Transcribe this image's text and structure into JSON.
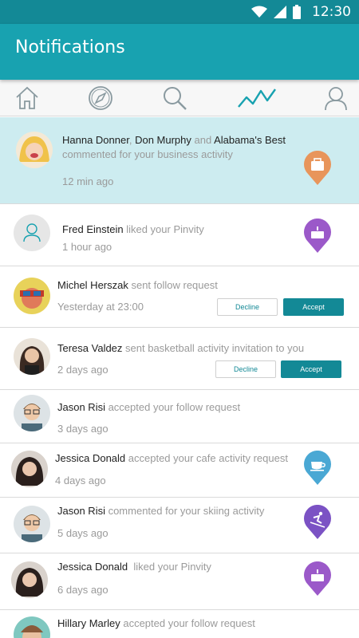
{
  "status_bar": {
    "time": "12:30"
  },
  "app_bar": {
    "title": "Notifications"
  },
  "nav": {
    "items": [
      {
        "name": "home-icon"
      },
      {
        "name": "compass-icon"
      },
      {
        "name": "search-icon"
      },
      {
        "name": "activity-icon",
        "active": true
      },
      {
        "name": "profile-icon"
      }
    ]
  },
  "notifications": [
    {
      "names": [
        "Hanna Donner",
        "Don Murphy",
        "Alabama's Best"
      ],
      "sep1": ", ",
      "conj": " and ",
      "text": "commented for your business activity",
      "time": "12 min ago",
      "badge": "briefcase-icon",
      "highlighted": true
    },
    {
      "name": "Fred Einstein",
      "text": " liked your Pinvity",
      "time": "1 hour ago",
      "badge": "cake-icon"
    },
    {
      "name": "Michel Herszak",
      "text": " sent follow request",
      "time": "Yesterday at 23:00",
      "decline": "Decline",
      "accept": "Accept"
    },
    {
      "name": "Teresa Valdez",
      "text": " sent basketball activity invitation to you",
      "time": "2 days ago",
      "decline": "Decline",
      "accept": "Accept"
    },
    {
      "name": "Jason Risi",
      "text": " accepted your follow request",
      "time": "3 days ago"
    },
    {
      "name": "Jessica Donald",
      "text": " accepted your cafe activity request",
      "time": "4 days ago",
      "badge": "coffee-icon"
    },
    {
      "name": "Jason Risi",
      "text": " commented for your skiing activity",
      "time": "5 days ago",
      "badge": "skiing-icon"
    },
    {
      "name": "Jessica Donald",
      "text": "  liked your Pinvity",
      "time": "6 days ago",
      "badge": "cake-icon"
    },
    {
      "name": "Hillary Marley",
      "text": " accepted your follow request",
      "time": ""
    }
  ],
  "colors": {
    "primary": "#18a2b0",
    "primary_dark": "#138996",
    "highlight_bg": "#cdecf0",
    "badge_orange": "#e8955b",
    "badge_purple": "#9b59c9",
    "badge_blue": "#4aa8d4",
    "badge_violet": "#7b52c4"
  }
}
